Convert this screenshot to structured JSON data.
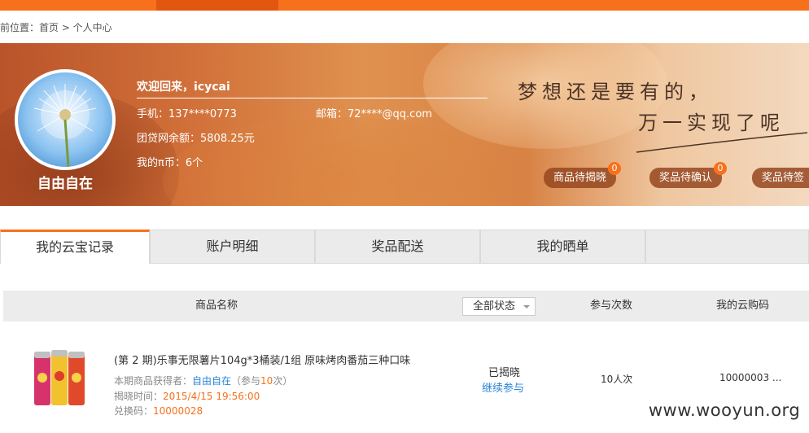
{
  "breadcrumb": "前位置：首页 > 个人中心",
  "user": {
    "nickname": "自由自在",
    "welcome": "欢迎回来，icycai",
    "phone": "手机：137****0773",
    "email": "邮箱：72****@qq.com",
    "balance": "团贷网余额：5808.25元",
    "coins": "我的π币：6个"
  },
  "slogan": {
    "line1": "梦想还是要有的，",
    "line2": "万一实现了呢"
  },
  "pills": [
    {
      "label": "商品待揭晓",
      "count": "0"
    },
    {
      "label": "奖品待确认",
      "count": "0"
    },
    {
      "label": "奖品待签"
    }
  ],
  "tabs": [
    "我的云宝记录",
    "账户明细",
    "奖品配送",
    "我的晒单"
  ],
  "table": {
    "col_name": "商品名称",
    "col_status_select": "全部状态",
    "col_times": "参与次数",
    "col_code": "我的云购码"
  },
  "record": {
    "name": "(第 2 期)乐事无限薯片104g*3桶装/1组 原味烤肉番茄三种口味",
    "winner_label": "本期商品获得者：",
    "winner": "自由自在",
    "join_prefix": "（参与",
    "join_count": "10",
    "join_suffix": "次）",
    "time_label": "揭晓时间：",
    "time": "2015/4/15 19:56:00",
    "code_label": "兑换码：",
    "code": "10000028",
    "status": "已揭晓",
    "continue": "继续参与",
    "times": "10人次",
    "yun_code": "10000003 ..."
  },
  "watermark": "www.wooyun.org",
  "colors": {
    "accent": "#f7701c",
    "link": "#2b84d8"
  }
}
